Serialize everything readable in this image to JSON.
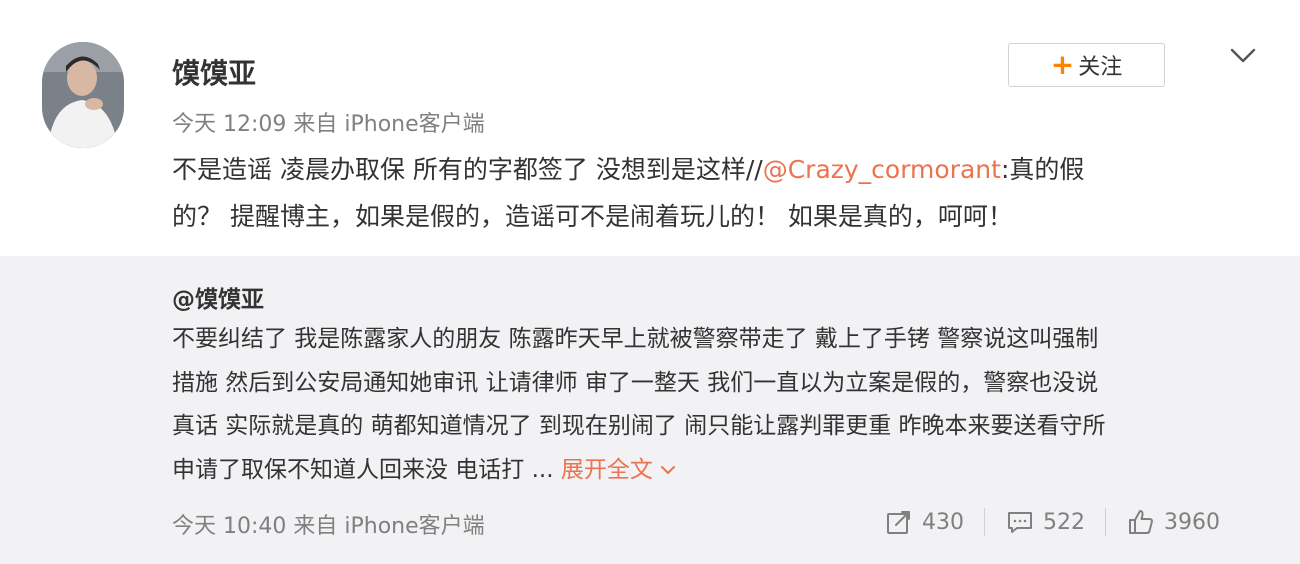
{
  "post": {
    "author": "馍馍亚",
    "meta": "今天 12:09 来自 iPhone客户端",
    "text_line1_before": "不是造谣 凌晨办取保 所有的字都签了 没想到是这样//",
    "mention": "@Crazy_cormorant",
    "text_line1_after": ":真的假",
    "text_line2": "的？ 提醒博主，如果是假的，造谣可不是闹着玩儿的！ 如果是真的，呵呵！"
  },
  "follow_button": {
    "plus": "+",
    "label": "关注"
  },
  "repost": {
    "original_author": "@馍馍亚",
    "lines": [
      "不要纠结了 我是陈露家人的朋友 陈露昨天早上就被警察带走了 戴上了手铐 警察说这叫强制",
      "措施 然后到公安局通知她审讯 让请律师 审了一整天 我们一直以为立案是假的，警察也没说",
      "真话 实际就是真的 萌都知道情况了 到现在别闹了 闹只能让露判罪更重 昨晚本来要送看守所"
    ],
    "last_line": "申请了取保不知道人回来没 电话打 ...",
    "expand_label": "展开全文",
    "time": "今天 10:40 来自 iPhone客户端",
    "actions": {
      "repost_count": "430",
      "comment_count": "522",
      "like_count": "3960"
    }
  },
  "colors": {
    "accent": "#eb7350",
    "follow_plus": "#ff8200",
    "repost_bg": "#f2f2f5",
    "meta_gray": "#808080"
  },
  "icons": [
    "chevron-down-icon",
    "plus-icon",
    "repost-icon",
    "comment-icon",
    "like-icon"
  ]
}
